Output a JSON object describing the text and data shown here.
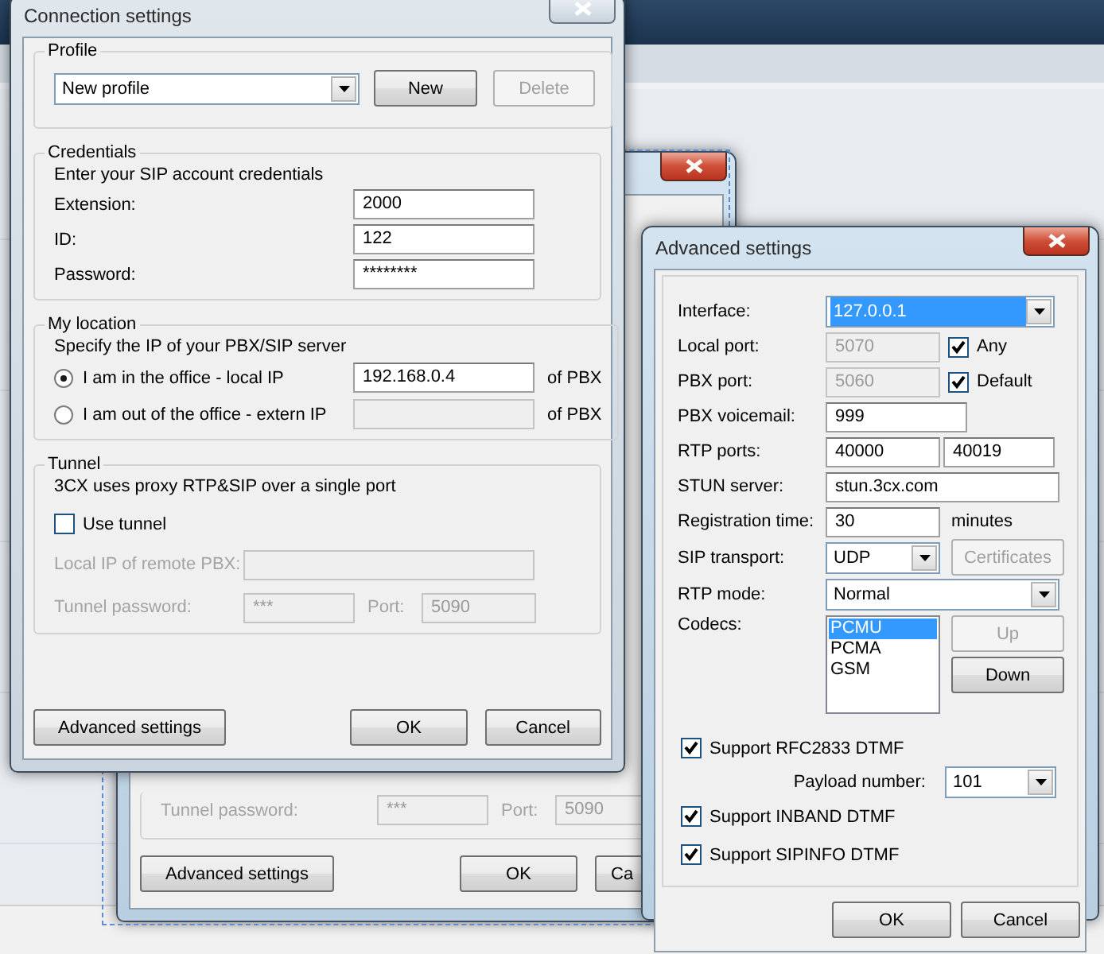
{
  "back_window": {
    "tunnel_password_label": "Tunnel password:",
    "tunnel_password": "***",
    "port_label": "Port:",
    "port": "5090",
    "buttons": [
      {
        "label": "Advanced settings"
      },
      {
        "label": "OK"
      },
      {
        "label": "Ca"
      }
    ]
  },
  "connection_window": {
    "title": "Connection settings",
    "active": false,
    "profile": {
      "legend": "Profile",
      "selected_profile": "New profile",
      "buttons": [
        {
          "label": "New",
          "disabled": false
        },
        {
          "label": "Delete",
          "disabled": true
        }
      ]
    },
    "credentials": {
      "legend": "Credentials",
      "intro": "Enter your SIP account credentials",
      "fields": [
        {
          "label": "Extension:",
          "value": "2000"
        },
        {
          "label": "ID:",
          "value": "122"
        },
        {
          "label": "Password:",
          "value": "********"
        }
      ]
    },
    "location": {
      "legend": "My location",
      "intro": "Specify the IP of your PBX/SIP server",
      "options": [
        {
          "label": "I am in the office - local IP",
          "selected": true,
          "value": "192.168.0.4",
          "disabled": false,
          "suffix": "of PBX"
        },
        {
          "label": "I am out of the office - extern IP",
          "selected": false,
          "disabled": true,
          "suffix": "of PBX"
        }
      ]
    },
    "tunnel": {
      "legend": "Tunnel",
      "intro": "3CX uses proxy RTP&SIP over a single port",
      "use_tunnel": {
        "label": "Use tunnel",
        "checked": false
      },
      "disabled": true,
      "remote_ip_label": "Local IP of remote PBX:",
      "password_label": "Tunnel password:",
      "password": "***",
      "port_label": "Port:",
      "port": "5090"
    },
    "buttons": [
      {
        "label": "Advanced settings"
      },
      {
        "label": "OK"
      },
      {
        "label": "Cancel"
      }
    ]
  },
  "advanced_window": {
    "title": "Advanced settings",
    "active": true,
    "interface": {
      "label": "Interface:",
      "value": "127.0.0.1",
      "selected": true
    },
    "local_port": {
      "label": "Local port:",
      "value": "5070",
      "disabled": true,
      "check": {
        "label": "Any",
        "checked": true
      }
    },
    "pbx_port": {
      "label": "PBX port:",
      "value": "5060",
      "disabled": true,
      "check": {
        "label": "Default",
        "checked": true
      }
    },
    "voicemail": {
      "label": "PBX voicemail:",
      "value": "999"
    },
    "rtp_ports": {
      "label": "RTP ports:",
      "from": "40000",
      "to": "40019"
    },
    "stun": {
      "label": "STUN server:",
      "value": "stun.3cx.com"
    },
    "registration": {
      "label": "Registration time:",
      "value": "30",
      "unit": "minutes"
    },
    "sip_transport": {
      "label": "SIP transport:",
      "value": "UDP",
      "button": {
        "label": "Certificates",
        "disabled": true
      }
    },
    "rtp_mode": {
      "label": "RTP mode:",
      "value": "Normal"
    },
    "codecs": {
      "label": "Codecs:",
      "items": [
        {
          "name": "PCMU",
          "selected": true
        },
        {
          "name": "PCMA",
          "selected": false
        },
        {
          "name": "GSM",
          "selected": false
        }
      ],
      "buttons": [
        {
          "label": "Up",
          "disabled": true
        },
        {
          "label": "Down",
          "disabled": false
        }
      ]
    },
    "rfc2833": {
      "label": "Support RFC2833 DTMF",
      "checked": true
    },
    "payload": {
      "label": "Payload number:",
      "value": "101"
    },
    "inband": {
      "label": "Support INBAND DTMF",
      "checked": true
    },
    "sipinfo": {
      "label": "Support SIPINFO DTMF",
      "checked": true
    },
    "buttons": [
      {
        "label": "OK"
      },
      {
        "label": "Cancel"
      }
    ]
  }
}
